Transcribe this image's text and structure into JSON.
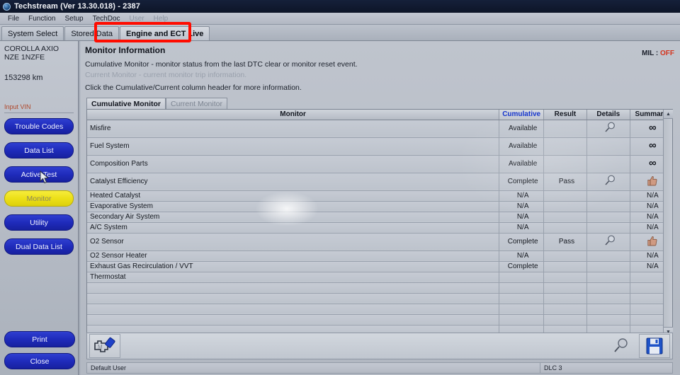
{
  "window": {
    "title": "Techstream (Ver 13.30.018) - 2387",
    "logo_icon": "techstream-logo-icon"
  },
  "menubar": {
    "items": [
      {
        "label": "File",
        "dim": false
      },
      {
        "label": "Function",
        "dim": false
      },
      {
        "label": "Setup",
        "dim": false
      },
      {
        "label": "TechDoc",
        "dim": false
      },
      {
        "label": "User",
        "dim": true
      },
      {
        "label": "Help",
        "dim": true
      }
    ]
  },
  "window_tabs": {
    "items": [
      {
        "label": "System Select",
        "active": false
      },
      {
        "label": "Stored Data",
        "active": false
      },
      {
        "label": "Engine and ECT Live",
        "active": true
      }
    ],
    "highlight_color": "#ff0c00"
  },
  "sidebar": {
    "vehicle_name": "COROLLA AXIO NZE 1NZFE",
    "odometer": "153298 km",
    "vin_link": "Input VIN",
    "nav_buttons": [
      {
        "label": "Trouble Codes",
        "selected": false
      },
      {
        "label": "Data List",
        "selected": false
      },
      {
        "label": "Active Test",
        "selected": false
      },
      {
        "label": "Monitor",
        "selected": true
      },
      {
        "label": "Utility",
        "selected": false
      },
      {
        "label": "Dual Data List",
        "selected": false
      }
    ],
    "bottom_buttons": [
      {
        "label": "Print"
      },
      {
        "label": "Close"
      }
    ],
    "button_color": "#1f2bbb",
    "selected_color": "#ece017"
  },
  "main": {
    "title": "Monitor Information",
    "line1": "Cumulative Monitor - monitor status from the last DTC clear or monitor reset event.",
    "line2": "Current Monitor - current monitor trip information.",
    "line3": "Click the Cumulative/Current column header for more information.",
    "mil_label": "MIL :",
    "mil_value": "OFF",
    "mil_color": "#d4361f"
  },
  "inner_tabs": [
    {
      "label": "Cumulative Monitor",
      "active": true
    },
    {
      "label": "Current Monitor",
      "active": false
    }
  ],
  "table": {
    "columns": [
      "Monitor",
      "Cumulative",
      "Result",
      "Details",
      "Summary"
    ],
    "cumulative_is_link": true,
    "link_color": "#1433cc",
    "rows": [
      {
        "monitor": "Misfire",
        "cumulative": "Available",
        "result": "",
        "details": "magnifier-icon",
        "summary": "∞",
        "tall": true
      },
      {
        "monitor": "Fuel System",
        "cumulative": "Available",
        "result": "",
        "details": "",
        "summary": "∞",
        "tall": true
      },
      {
        "monitor": "Composition Parts",
        "cumulative": "Available",
        "result": "",
        "details": "",
        "summary": "∞",
        "tall": true
      },
      {
        "monitor": "Catalyst Efficiency",
        "cumulative": "Complete",
        "result": "Pass",
        "details": "magnifier-icon",
        "summary": "thumbs-up-icon",
        "tall": true
      },
      {
        "monitor": "Heated Catalyst",
        "cumulative": "N/A",
        "result": "",
        "details": "",
        "summary": "N/A",
        "tall": false
      },
      {
        "monitor": "Evaporative System",
        "cumulative": "N/A",
        "result": "",
        "details": "",
        "summary": "N/A",
        "tall": false
      },
      {
        "monitor": "Secondary Air System",
        "cumulative": "N/A",
        "result": "",
        "details": "",
        "summary": "N/A",
        "tall": false
      },
      {
        "monitor": "A/C System",
        "cumulative": "N/A",
        "result": "",
        "details": "",
        "summary": "N/A",
        "tall": false
      },
      {
        "monitor": "O2 Sensor",
        "cumulative": "Complete",
        "result": "Pass",
        "details": "magnifier-icon",
        "summary": "thumbs-up-icon",
        "tall": true
      },
      {
        "monitor": "O2 Sensor Heater",
        "cumulative": "N/A",
        "result": "",
        "details": "",
        "summary": "N/A",
        "tall": false
      },
      {
        "monitor": "Exhaust Gas Recirculation / VVT",
        "cumulative": "Complete",
        "result": "",
        "details": "",
        "summary": "N/A",
        "tall": false
      },
      {
        "monitor": "Thermostat",
        "cumulative": "",
        "result": "",
        "details": "",
        "summary": "",
        "tall": false
      }
    ],
    "scroll_up_icon": "▲",
    "scroll_down_icon": "▼"
  },
  "toolbar": {
    "left_icon": "engine-connector-icon",
    "magnifier_icon": "magnifier-icon",
    "save_icon": "save-floppy-icon"
  },
  "statusbar": {
    "user": "Default User",
    "connection": "DLC 3"
  }
}
